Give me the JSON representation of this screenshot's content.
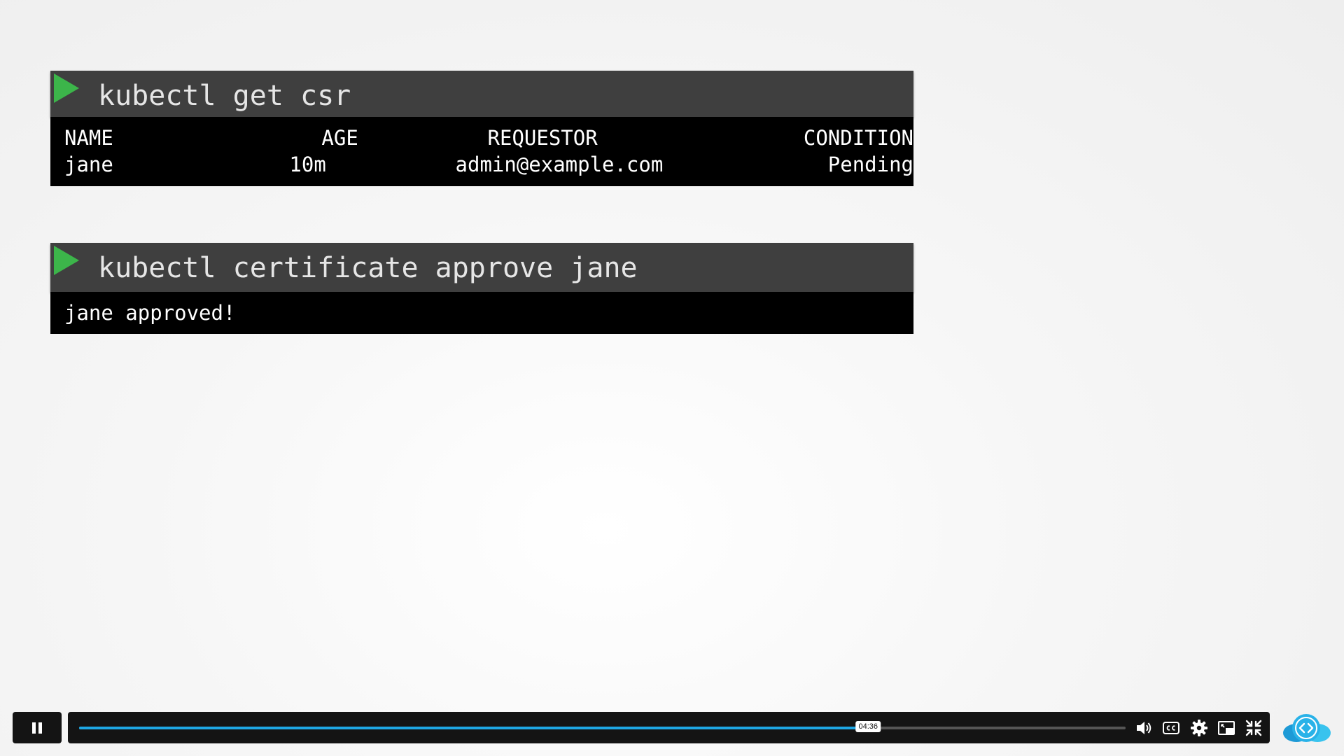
{
  "terminal_1": {
    "command": "kubectl get csr",
    "table": {
      "headers": [
        "NAME",
        "AGE",
        "REQUESTOR",
        "CONDITION"
      ],
      "rows": [
        [
          "jane",
          "10m",
          "admin@example.com",
          "Pending"
        ]
      ]
    }
  },
  "terminal_2": {
    "command": "kubectl certificate approve jane",
    "output": "jane approved!"
  },
  "player": {
    "current_time": "04:36",
    "progress_fraction": 0.754,
    "accent_color": "#1ea7e4",
    "icons": [
      "pause-icon",
      "volume-icon",
      "captions-icon",
      "gear-icon",
      "picture-in-picture-icon",
      "exit-fullscreen-icon",
      "code-cloud-icon"
    ]
  },
  "colors": {
    "command_header_bg": "#3f3f3f",
    "terminal_bg": "#000000",
    "prompt_arrow": "#3cb54a"
  }
}
